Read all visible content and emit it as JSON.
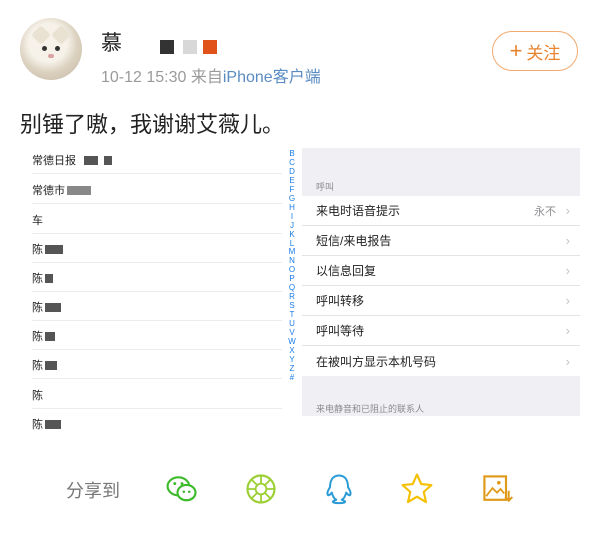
{
  "post": {
    "username": "慕",
    "time": "10-12 15:30",
    "source_prefix": "来自",
    "source": "iPhone客户端",
    "follow_label": "关注",
    "text": "别锤了嗷，我谢谢艾薇儿。"
  },
  "screenshot": {
    "contacts": [
      "常德日报",
      "常德市",
      "车",
      "陈",
      "陈",
      "陈",
      "陈",
      "陈",
      "陈",
      "陈"
    ],
    "alphabet": [
      "B",
      "C",
      "D",
      "E",
      "F",
      "G",
      "H",
      "I",
      "J",
      "K",
      "L",
      "M",
      "N",
      "O",
      "P",
      "Q",
      "R",
      "S",
      "T",
      "U",
      "V",
      "W",
      "X",
      "Y",
      "Z",
      "#"
    ],
    "calls_header": "呼叫",
    "settings_rows": [
      {
        "label": "来电时语音提示",
        "value": "永不"
      },
      {
        "label": "短信/来电报告",
        "value": ""
      },
      {
        "label": "以信息回复",
        "value": ""
      },
      {
        "label": "呼叫转移",
        "value": ""
      },
      {
        "label": "呼叫等待",
        "value": ""
      },
      {
        "label": "在被叫方显示本机号码",
        "value": ""
      }
    ],
    "blocked_header": "来电静音和已阻止的联系人"
  },
  "share": {
    "label": "分享到",
    "targets": [
      "wechat-icon",
      "moments-icon",
      "qq-icon",
      "qzone-icon",
      "save-image-icon"
    ]
  },
  "colors": {
    "accent": "#e7842d",
    "wechat": "#3dbb2d",
    "moments": "#9ccf34",
    "qq": "#2a9bd6",
    "qzone": "#f5c000",
    "save": "#e09a1a"
  }
}
